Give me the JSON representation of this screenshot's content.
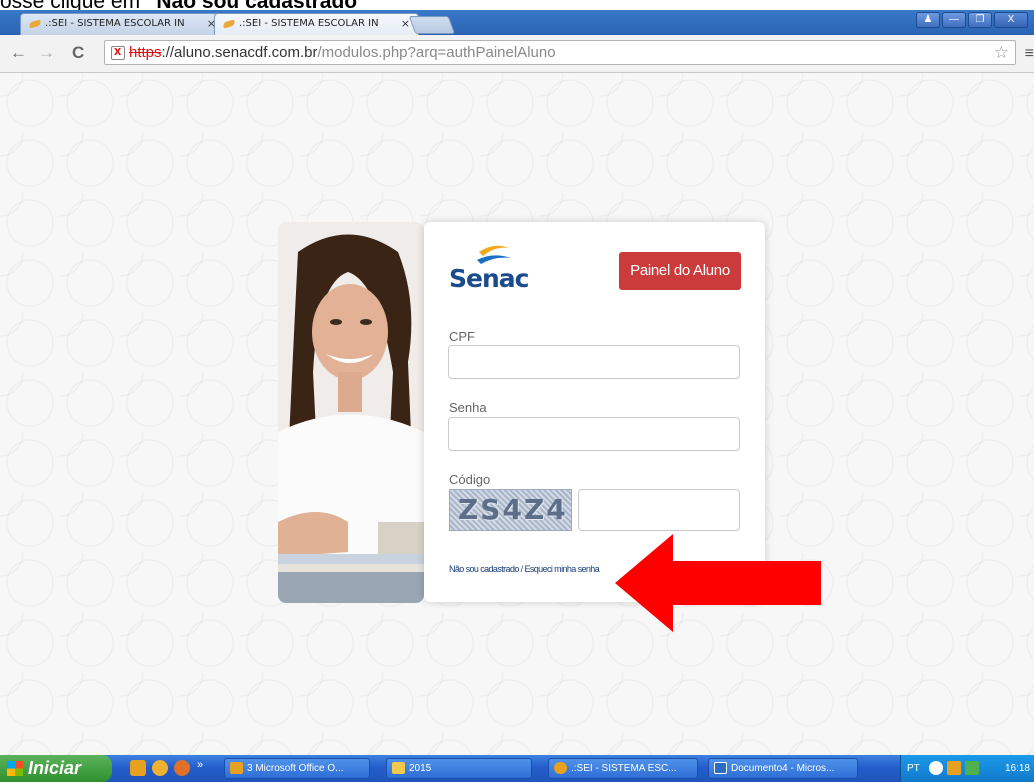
{
  "caption": {
    "prefix": "osse clique em ",
    "bold": "“Não sou cadastrado”"
  },
  "browser": {
    "tabs": [
      {
        "title": ".:SEI - SISTEMA ESCOLAR IN",
        "active": false
      },
      {
        "title": ".:SEI - SISTEMA ESCOLAR IN",
        "active": true
      }
    ],
    "tab_close": "×",
    "window_buttons": [
      "♟",
      "—",
      "❐",
      "X"
    ],
    "nav": {
      "back": "←",
      "forward": "→",
      "reload": "C"
    },
    "url": {
      "scheme": "https",
      "rest": "://aluno.senacdf.com.br",
      "path": "/modulos.php?arq=authPainelAluno"
    },
    "star": "☆",
    "menu": "≡"
  },
  "login": {
    "logo_text": "Senac",
    "panel_button": "Painel do Aluno",
    "cpf_label": "CPF",
    "cpf_value": "",
    "senha_label": "Senha",
    "senha_value": "",
    "codigo_label": "Código",
    "captcha_text": "ZS4Z4",
    "codigo_value": "",
    "register_link": "Não sou cadastrado / Esqueci minha senha"
  },
  "taskbar": {
    "start_label": "Iniciar",
    "chevron": "»",
    "buttons": [
      {
        "label": "3 Microsoft Office O...",
        "icon_color": "#e8a020"
      },
      {
        "label": "2015",
        "icon_color": "#f2c94c"
      },
      {
        "label": ".:SEI - SISTEMA ESC...",
        "icon_color": "#e8a020"
      },
      {
        "label": "Documento4 - Micros...",
        "icon_color": "#2b6cc4"
      }
    ],
    "lang": "PT",
    "clock": "16:18"
  },
  "colors": {
    "accent_red": "#cc3b3b",
    "brand_blue": "#1a4b8c",
    "arrow_red": "#ff0000"
  }
}
